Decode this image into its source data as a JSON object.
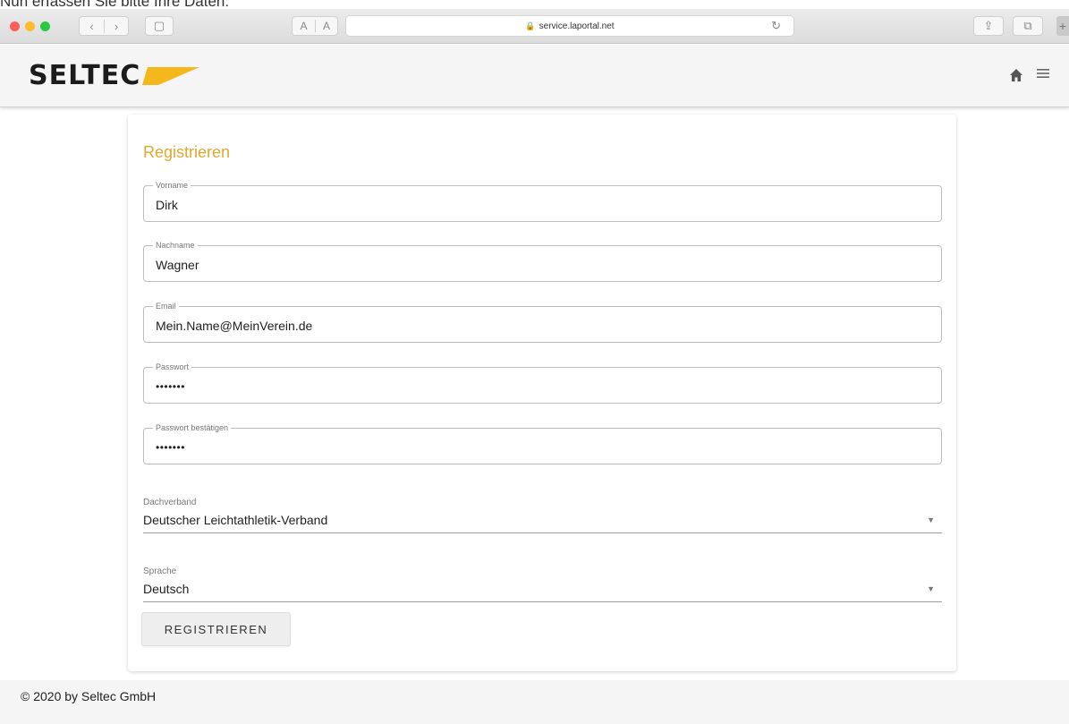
{
  "caption": "Nun erfassen Sie bitte Ihre Daten:",
  "browser": {
    "url": "service.laportal.net",
    "lock": "🔒",
    "back": "‹",
    "forward": "›",
    "sidebar": "▢",
    "text_small": "A",
    "text_large": "A",
    "reload": "↻",
    "share": "⇪",
    "tabs": "⧉",
    "new_tab": "+"
  },
  "header": {
    "logo_text": "SELTEC",
    "accent_color": "#f5b81c",
    "home_icon": "home-icon",
    "menu_icon": "menu-icon"
  },
  "form": {
    "title": "Registrieren",
    "fields": [
      {
        "label": "Vorname",
        "value": "Dirk"
      },
      {
        "label": "Nachname",
        "value": "Wagner"
      },
      {
        "label": "Email",
        "value": "Mein.Name@MeinVerein.de"
      },
      {
        "label": "Passwort",
        "value": "•••••••"
      },
      {
        "label": "Passwort bestätigen",
        "value": "•••••••"
      }
    ],
    "selects": [
      {
        "label": "Dachverband",
        "value": "Deutscher Leichtathletik-Verband"
      },
      {
        "label": "Sprache",
        "value": "Deutsch"
      }
    ],
    "submit_label": "REGISTRIEREN"
  },
  "footer": {
    "text": "© 2020 by Seltec GmbH"
  }
}
